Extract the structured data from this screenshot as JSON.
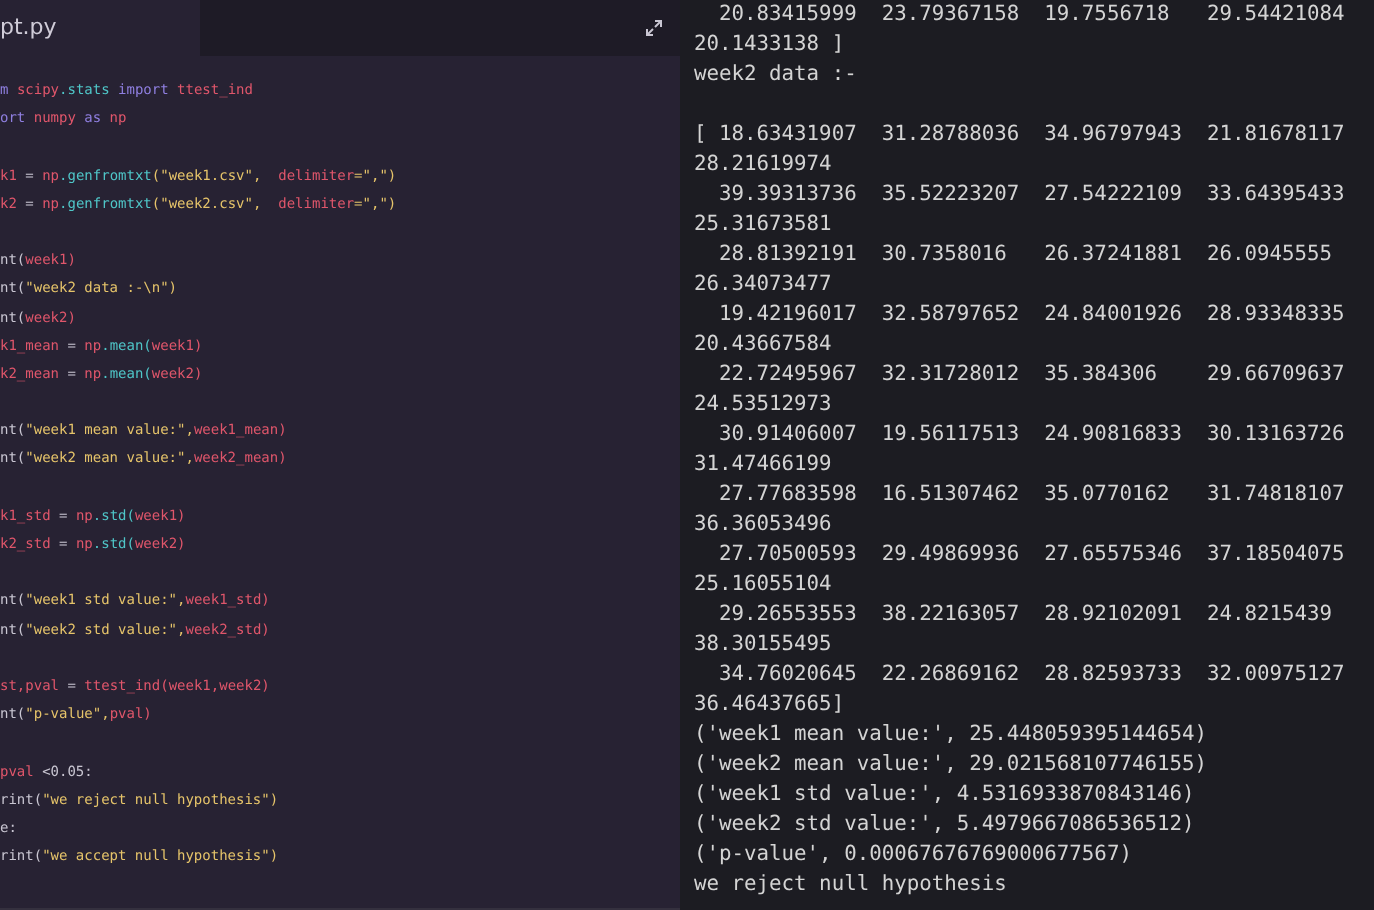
{
  "editor": {
    "tab": {
      "label": "pt.py",
      "selected": true
    },
    "blocks": [
      [
        [
          {
            "text": "m ",
            "kind": "kw"
          },
          {
            "text": "scipy",
            "kind": "var"
          },
          {
            "text": ".stats",
            "kind": "fn"
          },
          {
            "text": " import ",
            "kind": "kw"
          },
          {
            "text": "ttest_ind",
            "kind": "var"
          }
        ],
        [
          {
            "text": "ort ",
            "kind": "kw"
          },
          {
            "text": "numpy",
            "kind": "var"
          },
          {
            "text": " as ",
            "kind": "kw"
          },
          {
            "text": "np",
            "kind": "var"
          }
        ]
      ],
      [
        [
          {
            "text": "k1",
            "kind": "var"
          },
          {
            "text": " = ",
            "kind": "plain"
          },
          {
            "text": "np",
            "kind": "var"
          },
          {
            "text": ".genfromtxt",
            "kind": "fn"
          },
          {
            "text": "(\"week1.csv\",",
            "kind": "str"
          },
          {
            "text": "  delimiter",
            "kind": "var"
          },
          {
            "text": "=\",\")",
            "kind": "str"
          }
        ],
        [
          {
            "text": "k2",
            "kind": "var"
          },
          {
            "text": " = ",
            "kind": "plain"
          },
          {
            "text": "np",
            "kind": "var"
          },
          {
            "text": ".genfromtxt",
            "kind": "fn"
          },
          {
            "text": "(\"week2.csv\",",
            "kind": "str"
          },
          {
            "text": "  delimiter",
            "kind": "var"
          },
          {
            "text": "=\",\")",
            "kind": "str"
          }
        ]
      ],
      [
        [
          {
            "text": "nt(",
            "kind": "plain"
          },
          {
            "text": "week1)",
            "kind": "var"
          }
        ],
        [
          {
            "text": "nt(",
            "kind": "plain"
          },
          {
            "text": "\"week2 data :-\\n\")",
            "kind": "str"
          }
        ],
        [
          {
            "text": "nt(",
            "kind": "plain"
          },
          {
            "text": "week2)",
            "kind": "var"
          }
        ],
        [
          {
            "text": "k1_mean",
            "kind": "var"
          },
          {
            "text": " = ",
            "kind": "plain"
          },
          {
            "text": "np",
            "kind": "var"
          },
          {
            "text": ".mean(",
            "kind": "fn"
          },
          {
            "text": "week1)",
            "kind": "var"
          }
        ],
        [
          {
            "text": "k2_mean",
            "kind": "var"
          },
          {
            "text": " = ",
            "kind": "plain"
          },
          {
            "text": "np",
            "kind": "var"
          },
          {
            "text": ".mean(",
            "kind": "fn"
          },
          {
            "text": "week2)",
            "kind": "var"
          }
        ]
      ],
      [
        [
          {
            "text": "nt(",
            "kind": "plain"
          },
          {
            "text": "\"week1 mean value:\",",
            "kind": "str"
          },
          {
            "text": "week1_mean)",
            "kind": "var"
          }
        ],
        [
          {
            "text": "nt(",
            "kind": "plain"
          },
          {
            "text": "\"week2 mean value:\",",
            "kind": "str"
          },
          {
            "text": "week2_mean)",
            "kind": "var"
          }
        ]
      ],
      [
        [
          {
            "text": "k1_std",
            "kind": "var"
          },
          {
            "text": " = ",
            "kind": "plain"
          },
          {
            "text": "np",
            "kind": "var"
          },
          {
            "text": ".std(",
            "kind": "fn"
          },
          {
            "text": "week1)",
            "kind": "var"
          }
        ],
        [
          {
            "text": "k2_std",
            "kind": "var"
          },
          {
            "text": " = ",
            "kind": "plain"
          },
          {
            "text": "np",
            "kind": "var"
          },
          {
            "text": ".std(",
            "kind": "fn"
          },
          {
            "text": "week2)",
            "kind": "var"
          }
        ]
      ],
      [
        [
          {
            "text": "nt(",
            "kind": "plain"
          },
          {
            "text": "\"week1 std value:\",",
            "kind": "str"
          },
          {
            "text": "week1_std)",
            "kind": "var"
          }
        ],
        [
          {
            "text": "nt(",
            "kind": "plain"
          },
          {
            "text": "\"week2 std value:\",",
            "kind": "str"
          },
          {
            "text": "week2_std)",
            "kind": "var"
          }
        ]
      ],
      [
        [
          {
            "text": "st,pval",
            "kind": "var"
          },
          {
            "text": " = ",
            "kind": "plain"
          },
          {
            "text": "ttest_ind(week1,week2)",
            "kind": "var"
          }
        ],
        [
          {
            "text": "nt(",
            "kind": "plain"
          },
          {
            "text": "\"p-value\",",
            "kind": "str"
          },
          {
            "text": "pval)",
            "kind": "var"
          }
        ]
      ],
      [
        [
          {
            "text": "pval",
            "kind": "var"
          },
          {
            "text": " <0.05:",
            "kind": "plain"
          }
        ],
        [
          {
            "text": "rint(",
            "kind": "plain"
          },
          {
            "text": "\"we reject null hypothesis\")",
            "kind": "str"
          }
        ],
        [
          {
            "text": "e:",
            "kind": "plain"
          }
        ],
        [
          {
            "text": "rint(",
            "kind": "plain"
          },
          {
            "text": "\"we accept null hypothesis\")",
            "kind": "str"
          }
        ]
      ]
    ]
  },
  "terminal": {
    "blocks": [
      [
        "  20.83415999  23.79367158  19.7556718   29.54421084",
        "20.1433138 ]",
        "week2 data :-"
      ],
      [
        "[ 18.63431907  31.28788036  34.96797943  21.81678117",
        "28.21619974",
        "  39.39313736  35.52223207  27.54222109  33.64395433",
        "25.31673581",
        "  28.81392191  30.7358016   26.37241881  26.0945555",
        "26.34073477",
        "  19.42196017  32.58797652  24.84001926  28.93348335",
        "20.43667584",
        "  22.72495967  32.31728012  35.384306    29.66709637",
        "24.53512973",
        "  30.91406007  19.56117513  24.90816833  30.13163726",
        "31.47466199",
        "  27.77683598  16.51307462  35.0770162   31.74818107",
        "36.36053496",
        "  27.70500593  29.49869936  27.65575346  37.18504075",
        "25.16055104",
        "  29.26553553  38.22163057  28.92102091  24.8215439",
        "38.30155495",
        "  34.76020645  22.26869162  28.82593733  32.00975127",
        "36.46437665]",
        "('week1 mean value:', 25.448059395144654)",
        "('week2 mean value:', 29.021568107746155)",
        "('week1 std value:', 4.5316933870843146)",
        "('week2 std value:', 5.4979667086536512)",
        "('p-value', 0.00067676769000677567)",
        "we reject null hypothesis"
      ]
    ]
  }
}
